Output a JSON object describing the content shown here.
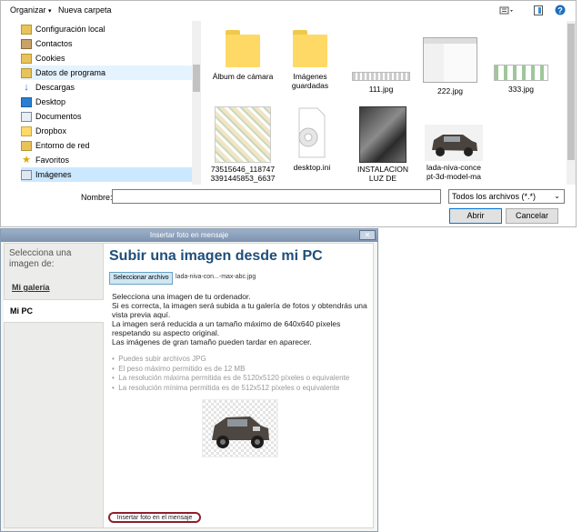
{
  "file_dialog": {
    "toolbar": {
      "organize_label": "Organizar",
      "new_folder_label": "Nueva carpeta"
    },
    "nav_items": [
      {
        "label": "Configuración local",
        "icon": "gear-folder-icon"
      },
      {
        "label": "Contactos",
        "icon": "contacts-icon"
      },
      {
        "label": "Cookies",
        "icon": "folder-icon"
      },
      {
        "label": "Datos de programa",
        "icon": "folder-icon"
      },
      {
        "label": "Descargas",
        "icon": "download-icon"
      },
      {
        "label": "Desktop",
        "icon": "desktop-icon"
      },
      {
        "label": "Documentos",
        "icon": "documents-icon"
      },
      {
        "label": "Dropbox",
        "icon": "dropbox-icon"
      },
      {
        "label": "Entorno de red",
        "icon": "network-folder-icon"
      },
      {
        "label": "Favoritos",
        "icon": "star-icon"
      },
      {
        "label": "Imágenes",
        "icon": "pictures-icon"
      }
    ],
    "files": [
      {
        "name": "Álbum de cámara",
        "kind": "folder"
      },
      {
        "name": "Imágenes guardadas",
        "kind": "folder"
      },
      {
        "name": "111.jpg",
        "kind": "image"
      },
      {
        "name": "222.jpg",
        "kind": "image"
      },
      {
        "name": "333.jpg",
        "kind": "image"
      },
      {
        "name": "73515646_118747 3391445853_6637",
        "kind": "image"
      },
      {
        "name": "desktop.ini",
        "kind": "settings"
      },
      {
        "name": "INSTALACION LUZ DE",
        "kind": "image"
      },
      {
        "name": "lada-niva-conce pt-3d-model-ma",
        "kind": "image"
      }
    ],
    "filename_label": "Nombre:",
    "filename_value": "",
    "file_type": "Todos los archivos (*.*)",
    "open_label": "Abrir",
    "cancel_label": "Cancelar"
  },
  "insert_window": {
    "title": "Insertar foto en mensaje",
    "sidebar_title": "Selecciona una imagen de:",
    "gallery_link": "Mi galería",
    "mypc_tab": "Mi PC",
    "upload_heading": "Subir una imagen desde mi PC",
    "choose_file_label": "Seleccionar archivo",
    "chosen_file": "lada-niva-con...-max-abc.jpg",
    "instructions": [
      "Selecciona una imagen de tu ordenador.",
      "Si es correcta, la imagen será subida a tu galería de fotos y obtendrás una vista previa aquí.",
      "La imagen será reducida a un tamaño máximo de 640x640 píxeles respetando su aspecto original.",
      "Las imágenes de gran tamaño pueden tardar en aparecer."
    ],
    "rules": [
      "Puedes subir archivos JPG",
      "El peso máximo permitido es de 12 MB",
      "La resolución máxima permitida es de 5120x5120 píxeles o equivalente",
      "La resolución mínima permitida es de 512x512 píxeles o equivalente"
    ],
    "insert_button": "Insertar foto en el mensaje"
  }
}
